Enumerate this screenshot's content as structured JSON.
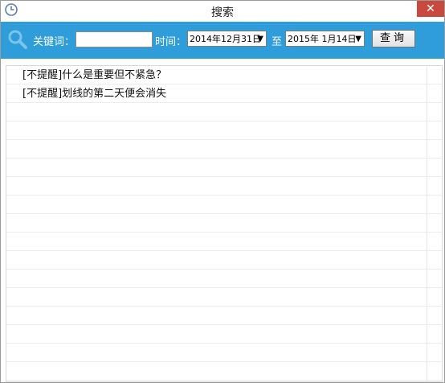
{
  "window": {
    "title": "搜索",
    "close_label": "✕"
  },
  "toolbar": {
    "keyword_label": "关键词：",
    "keyword_value": "",
    "time_label": "时间：",
    "start_date": "2014年12月31日",
    "to_label": "至",
    "end_date": "2015年  1月14日",
    "query_label": "查询"
  },
  "results": [
    {
      "text": "[不提醒]什么是重要但不紧急？"
    },
    {
      "text": "[不提醒]划线的第二天便会消失"
    }
  ],
  "icons": {
    "title": "clock-icon",
    "search": "search-icon",
    "dropdown": "chevron-down-icon",
    "close": "close-icon"
  },
  "colors": {
    "toolbar_bg": "#2f9dd9",
    "close_bg": "#c84a3f"
  }
}
